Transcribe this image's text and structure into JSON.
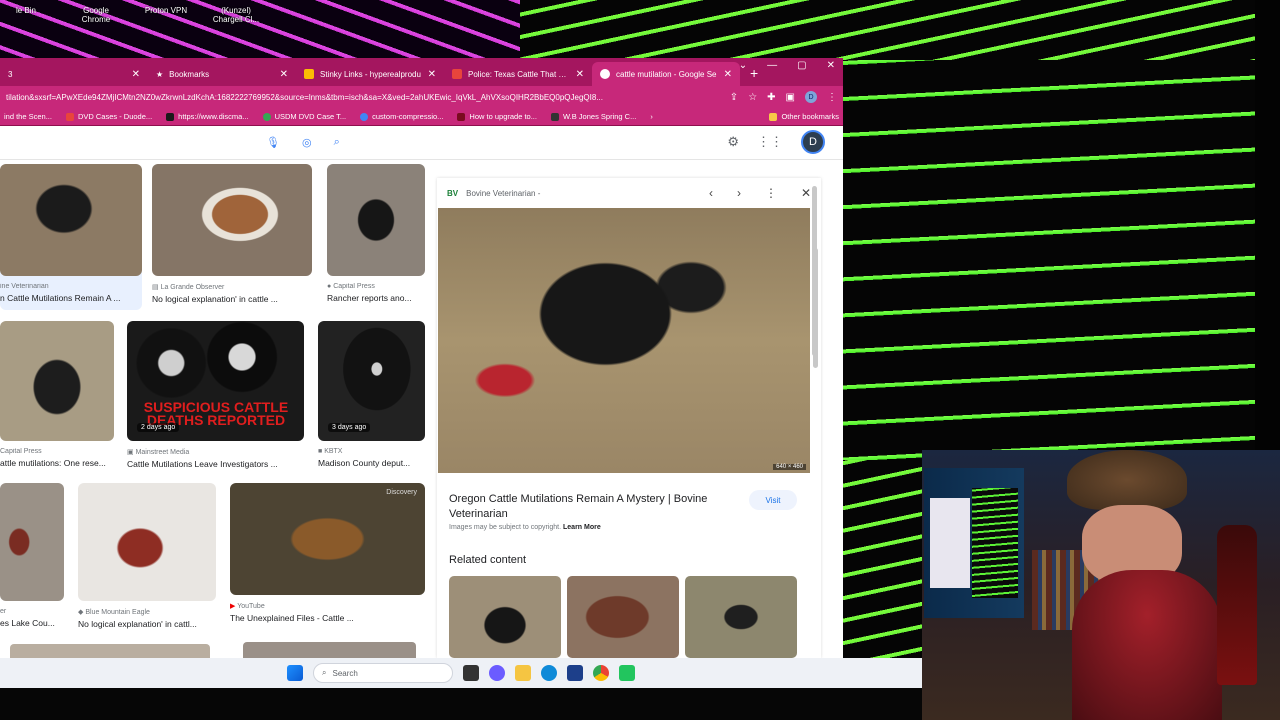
{
  "desktop": {
    "icons": [
      {
        "label": "le Bin"
      },
      {
        "label": "Google Chrome"
      },
      {
        "label": "Proton VPN"
      },
      {
        "label": "(Kunzel) Chargell Cl..."
      }
    ]
  },
  "browser": {
    "tabs": [
      {
        "title": "3",
        "active": false
      },
      {
        "title": "Bookmarks",
        "active": false
      },
      {
        "title": "Stinky Links - hyperealprodu",
        "active": false
      },
      {
        "title": "Police: Texas Cattle That Die",
        "active": false
      },
      {
        "title": "cattle mutilation - Google Se",
        "active": true
      }
    ],
    "new_tab": "+",
    "url": "tilation&sxsrf=APwXEde94ZMjICMtn2NZ0wZkrwnLzdKchA:1682222769952&source=lnms&tbm=isch&sa=X&ved=2ahUKEwic_IqVkL_AhVXsoQIHR2BbEQ0pQJegQI8...",
    "profile_initial": "D",
    "bookmarks": [
      "ind the Scen...",
      "DVD Cases - Duode...",
      "https://www.discma...",
      "USDM DVD Case T...",
      "custom-compressio...",
      "How to upgrade to...",
      "W.B Jones Spring C..."
    ],
    "other_bookmarks": "Other bookmarks"
  },
  "google": {
    "avatar_initial": "D"
  },
  "results": [
    {
      "source": "ine Veterinarian",
      "title": "n Cattle Mutilations Remain A ...",
      "badge": ""
    },
    {
      "source": "La Grande Observer",
      "title": "No logical explanation' in cattle ...",
      "badge": ""
    },
    {
      "source": "Capital Press",
      "title": "Rancher reports ano...",
      "badge": ""
    },
    {
      "source": "Capital Press",
      "title": "attle mutilations: One rese...",
      "badge": ""
    },
    {
      "source": "Mainstreet Media",
      "title": "Cattle Mutilations Leave Investigators ...",
      "badge": "2 days ago",
      "overlay": "SUSPICIOUS CATTLE DEATHS REPORTED"
    },
    {
      "source": "KBTX",
      "title": "Madison County deput...",
      "badge": "3 days ago"
    },
    {
      "source": "er",
      "title": "es Lake Cou...",
      "badge": ""
    },
    {
      "source": "Blue Mountain Eagle",
      "title": "No logical explanation' in cattl...",
      "badge": ""
    },
    {
      "source": "YouTube",
      "title": "The Unexplained Files - Cattle ...",
      "badge": "",
      "overlay": "Discovery"
    }
  ],
  "preview": {
    "source_badge": "BV",
    "source": "Bovine Veterinarian -",
    "title": "Oregon Cattle Mutilations Remain A Mystery | Bovine Veterinarian",
    "visit": "Visit",
    "copyright": "Images may be subject to copyright.",
    "learn_more": "Learn More",
    "related": "Related content",
    "dims": "640 × 460"
  },
  "taskbar": {
    "search": "Search"
  }
}
